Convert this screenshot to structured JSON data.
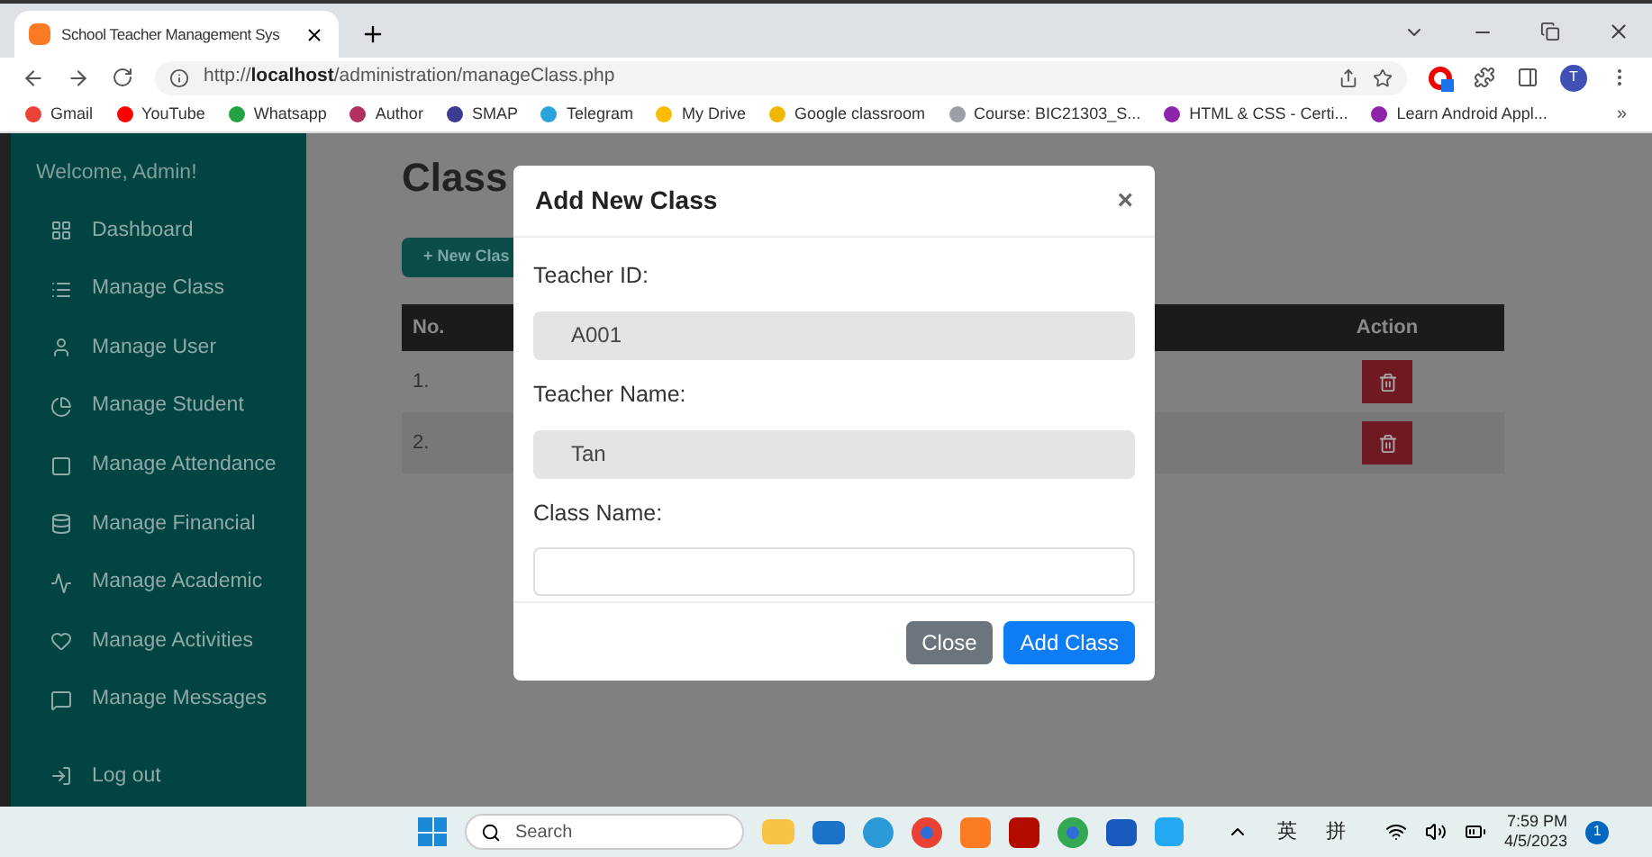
{
  "browser": {
    "tab_title": "School Teacher Management Sys",
    "url_prefix": "http://",
    "url_host": "localhost",
    "url_path": "/administration/manageClass.php",
    "profile": "T",
    "bookmarks": [
      {
        "label": "Gmail",
        "color": "#ea4335"
      },
      {
        "label": "YouTube",
        "color": "#ff0000"
      },
      {
        "label": "Whatsapp",
        "color": "#25a244"
      },
      {
        "label": "Author",
        "color": "#b03060"
      },
      {
        "label": "SMAP",
        "color": "#3b3b8f"
      },
      {
        "label": "Telegram",
        "color": "#2aa3dd"
      },
      {
        "label": "My Drive",
        "color": "#fbbc04"
      },
      {
        "label": "Google classroom",
        "color": "#f2b705"
      },
      {
        "label": "Course: BIC21303_S...",
        "color": "#9aa0a6"
      },
      {
        "label": "HTML & CSS - Certi...",
        "color": "#8e24aa"
      },
      {
        "label": "Learn Android Appl...",
        "color": "#8e24aa"
      }
    ],
    "more": "»"
  },
  "sidebar": {
    "welcome": "Welcome, Admin!",
    "items": [
      {
        "label": "Dashboard"
      },
      {
        "label": "Manage Class"
      },
      {
        "label": "Manage User"
      },
      {
        "label": "Manage Student"
      },
      {
        "label": "Manage Attendance"
      },
      {
        "label": "Manage Financial"
      },
      {
        "label": "Manage Academic"
      },
      {
        "label": "Manage Activities"
      },
      {
        "label": "Manage Messages"
      }
    ],
    "logout": "Log out"
  },
  "main": {
    "heading": "Class",
    "new_button": "+ New Clas",
    "table": {
      "columns": [
        "No.",
        "Action"
      ],
      "rows": [
        {
          "no": "1."
        },
        {
          "no": "2."
        }
      ]
    }
  },
  "modal": {
    "title": "Add New Class",
    "close_icon": "×",
    "fields": [
      {
        "label": "Teacher ID:",
        "value": "A001",
        "disabled": true
      },
      {
        "label": "Teacher Name:",
        "value": "Tan",
        "disabled": true
      },
      {
        "label": "Class Name:",
        "disabled": false
      }
    ],
    "buttons": [
      {
        "label": "Close",
        "kind": "secondary"
      },
      {
        "label": "Add Class",
        "kind": "primary"
      }
    ]
  },
  "taskbar": {
    "search_placeholder": "Search",
    "ime": [
      "英",
      "拼"
    ],
    "time": "7:59 PM",
    "date": "4/5/2023",
    "notifications": "1"
  }
}
